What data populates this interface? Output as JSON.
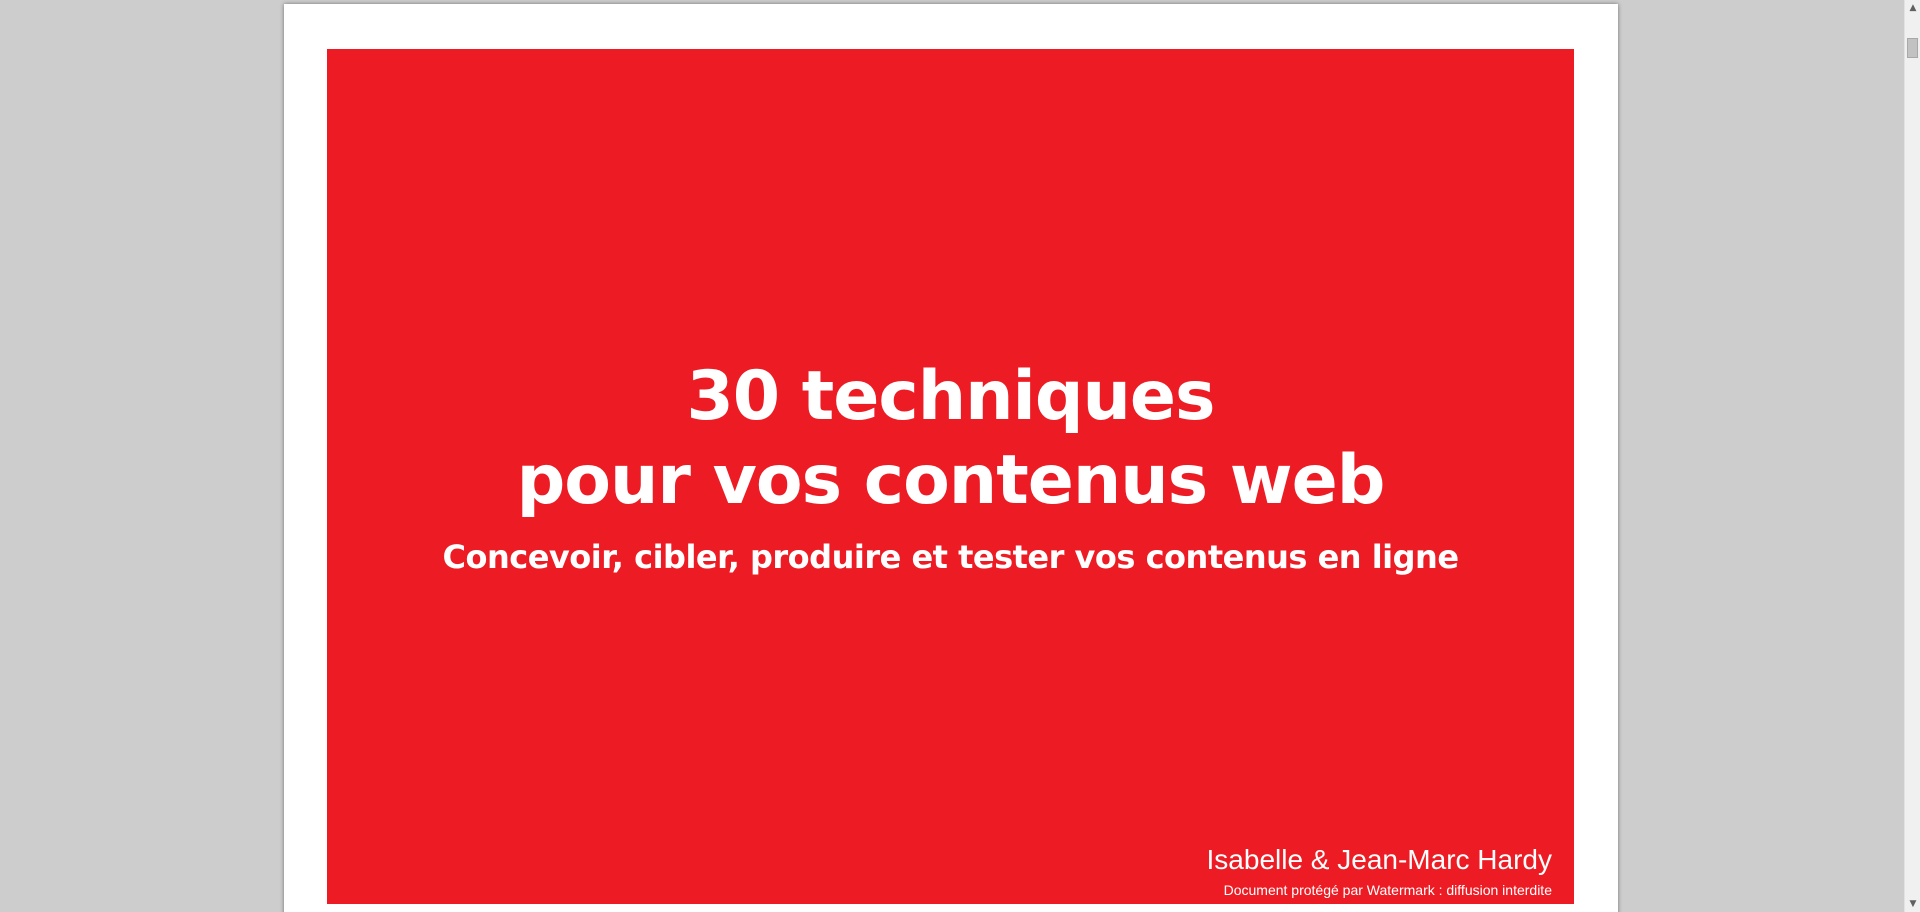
{
  "document": {
    "cover": {
      "title_line_1": "30 techniques",
      "title_line_2": "pour vos contenus web",
      "subtitle": "Concevoir, cibler, produire et tester vos contenus en ligne",
      "authors": "Isabelle & Jean-Marc Hardy",
      "watermark": "Document protégé par Watermark : diffusion interdite"
    }
  },
  "scrollbar": {
    "up_arrow": "▲",
    "down_arrow": "▼",
    "position": 0.0
  },
  "colors": {
    "cover_background": "#ed1c24",
    "viewer_background": "#cdcdcd",
    "text": "#ffffff"
  }
}
